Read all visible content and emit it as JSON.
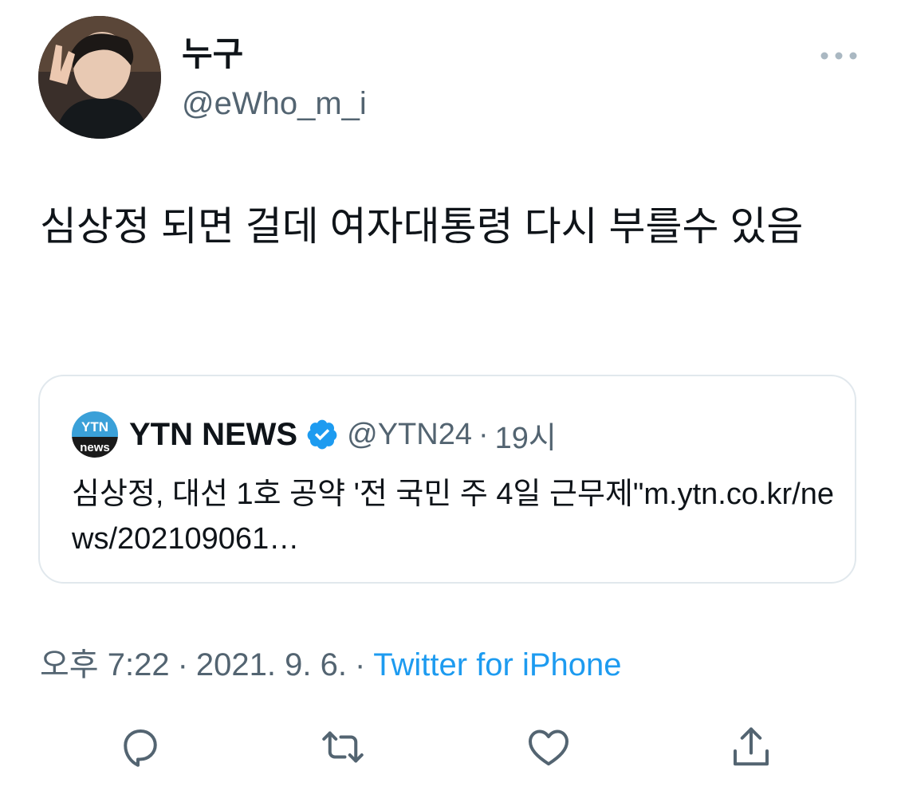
{
  "author": {
    "display_name": "누구",
    "handle": "@eWho_m_i"
  },
  "icons": {
    "more": "more-horizontal-icon",
    "reply": "reply-icon",
    "retweet": "retweet-icon",
    "like": "heart-icon",
    "share": "share-icon",
    "verified": "verified-badge-icon"
  },
  "tweet": {
    "text": "심상정 되면 걸데 여자대통령 다시 부를수 있음"
  },
  "quoted_tweet": {
    "display_name": "YTN NEWS",
    "handle": "@YTN24",
    "separator": "·",
    "time": "19시",
    "text": "심상정, 대선 1호 공약 '전 국민 주 4일 근무제\"m.ytn.co.kr/news/202109061…",
    "logo_text_top": "YTN",
    "logo_text_bottom": "news"
  },
  "meta": {
    "time": "오후 7:22",
    "separator": "·",
    "date": "2021. 9. 6.",
    "source": "Twitter for iPhone"
  },
  "colors": {
    "text": "#0f1419",
    "secondary": "#536471",
    "accent": "#1d9bf0",
    "border": "#e1e8ed"
  }
}
